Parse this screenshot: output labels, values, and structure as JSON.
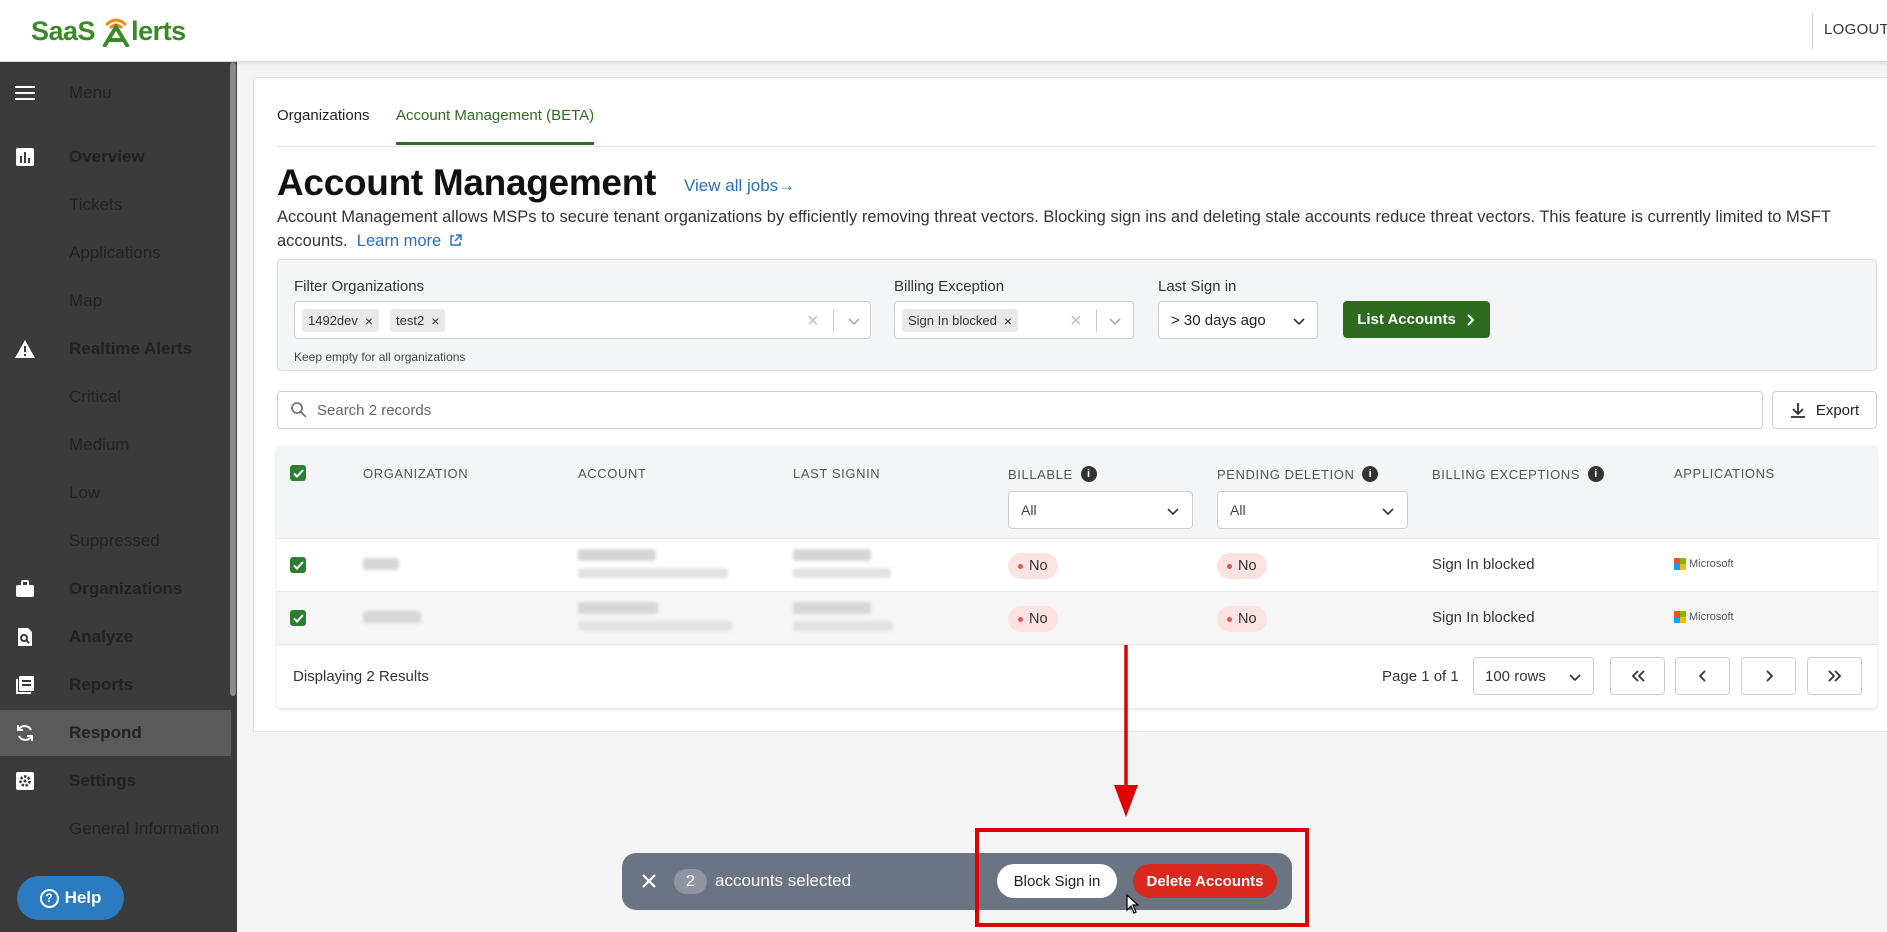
{
  "header": {
    "logo_text_left": "SaaS",
    "logo_text_right": "lerts",
    "logout": "LOGOUT"
  },
  "sidebar": {
    "items": [
      {
        "label": "Menu",
        "icon": "hamburger-icon"
      },
      {
        "label": "Overview",
        "icon": "chart-icon"
      },
      {
        "label": "Tickets"
      },
      {
        "label": "Applications"
      },
      {
        "label": "Map"
      },
      {
        "label": "Realtime Alerts",
        "icon": "warning-icon"
      },
      {
        "label": "Critical"
      },
      {
        "label": "Medium"
      },
      {
        "label": "Low"
      },
      {
        "label": "Suppressed"
      },
      {
        "label": "Organizations",
        "icon": "briefcase-icon"
      },
      {
        "label": "Analyze",
        "icon": "analyze-icon"
      },
      {
        "label": "Reports",
        "icon": "reports-icon"
      },
      {
        "label": "Respond",
        "icon": "refresh-icon"
      },
      {
        "label": "Settings",
        "icon": "gear-icon"
      },
      {
        "label": "General Information"
      }
    ],
    "help": "Help"
  },
  "tabs": [
    "Organizations",
    "Account Management (BETA)"
  ],
  "page": {
    "title": "Account Management",
    "view_jobs": "View all jobs→",
    "description": "Account Management allows MSPs to secure tenant organizations by efficiently removing threat vectors. Blocking sign ins and deleting stale accounts reduce threat vectors. This feature is currently limited to MSFT accounts.",
    "learn_more": "Learn more"
  },
  "filters": {
    "org_label": "Filter Organizations",
    "org_chips": [
      "1492dev",
      "test2"
    ],
    "org_hint": "Keep empty for all organizations",
    "billing_label": "Billing Exception",
    "billing_chip": "Sign In blocked",
    "last_signin_label": "Last Sign in",
    "last_signin_value": "> 30 days ago",
    "list_button": "List Accounts"
  },
  "search": {
    "placeholder": "Search 2 records",
    "export": "Export"
  },
  "table": {
    "columns": [
      "ORGANIZATION",
      "ACCOUNT",
      "LAST SIGNIN",
      "BILLABLE",
      "PENDING DELETION",
      "BILLING EXCEPTIONS",
      "APPLICATIONS"
    ],
    "billable_filter": "All",
    "pending_filter": "All",
    "rows": [
      {
        "billable": "No",
        "pending": "No",
        "exception": "Sign In blocked",
        "app": "Microsoft"
      },
      {
        "billable": "No",
        "pending": "No",
        "exception": "Sign In blocked",
        "app": "Microsoft"
      }
    ],
    "displaying": "Displaying 2 Results",
    "page_info": "Page 1 of 1",
    "rows_per_page": "100 rows"
  },
  "action_bar": {
    "count": "2",
    "text": "accounts selected",
    "block": "Block Sign in",
    "delete": "Delete Accounts"
  },
  "colors": {
    "brand_green": "#2f6b1f",
    "danger": "#d9281e",
    "sidebar": "#3b3b3b"
  }
}
